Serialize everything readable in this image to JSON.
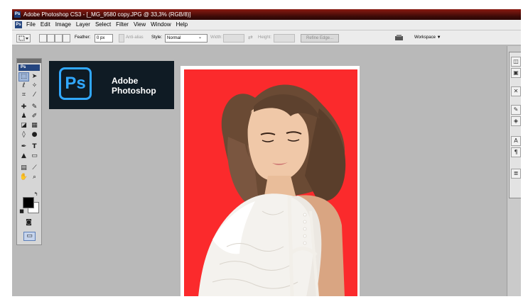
{
  "window": {
    "app_icon": "Ps",
    "title": "Adobe Photoshop CS3 - [_MG_9580 copy.JPG @ 33,3% (RGB/8)]"
  },
  "menubar": {
    "badge": "Ps",
    "items": [
      "File",
      "Edit",
      "Image",
      "Layer",
      "Select",
      "Filter",
      "View",
      "Window",
      "Help"
    ]
  },
  "options": {
    "feather_label": "Feather:",
    "feather_value": "0 px",
    "antialias_label": "Anti-alias",
    "style_label": "Style:",
    "style_value": "Normal",
    "width_label": "Width:",
    "height_label": "Height:",
    "refine_edge": "Refine Edge...",
    "workspace": "Workspace ▼"
  },
  "toolbox": {
    "badge": "Ps",
    "foreground_color": "#000000",
    "background_color": "#ffffff"
  },
  "logo": {
    "mark": "Ps",
    "line1": "Adobe",
    "line2": "Photoshop",
    "accent": "#31a8ff"
  },
  "document": {
    "background_color": "#fb2a2c"
  },
  "icons": {
    "tools": [
      "marquee-icon",
      "move-icon",
      "lasso-icon",
      "magic-wand-icon",
      "crop-icon",
      "slice-icon",
      "healing-icon",
      "brush-icon",
      "clone-stamp-icon",
      "history-brush-icon",
      "eraser-icon",
      "gradient-icon",
      "blur-icon",
      "dodge-icon",
      "pen-icon",
      "type-icon",
      "path-select-icon",
      "shape-icon",
      "notes-icon",
      "eyedropper-icon",
      "hand-icon",
      "zoom-icon"
    ],
    "panels": [
      "navigator-icon",
      "history-icon",
      "actions-icon",
      "brushes-icon",
      "tool-presets-icon",
      "character-icon",
      "paragraph-icon",
      "layers-icon"
    ]
  }
}
